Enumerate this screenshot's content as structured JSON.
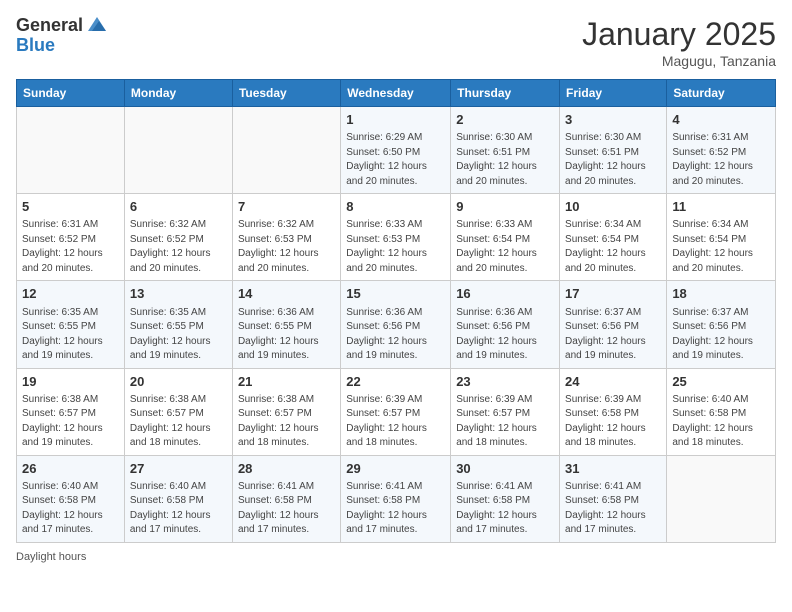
{
  "header": {
    "logo_general": "General",
    "logo_blue": "Blue",
    "month_title": "January 2025",
    "location": "Magugu, Tanzania"
  },
  "days_of_week": [
    "Sunday",
    "Monday",
    "Tuesday",
    "Wednesday",
    "Thursday",
    "Friday",
    "Saturday"
  ],
  "weeks": [
    [
      {
        "day": "",
        "info": ""
      },
      {
        "day": "",
        "info": ""
      },
      {
        "day": "",
        "info": ""
      },
      {
        "day": "1",
        "info": "Sunrise: 6:29 AM\nSunset: 6:50 PM\nDaylight: 12 hours\nand 20 minutes."
      },
      {
        "day": "2",
        "info": "Sunrise: 6:30 AM\nSunset: 6:51 PM\nDaylight: 12 hours\nand 20 minutes."
      },
      {
        "day": "3",
        "info": "Sunrise: 6:30 AM\nSunset: 6:51 PM\nDaylight: 12 hours\nand 20 minutes."
      },
      {
        "day": "4",
        "info": "Sunrise: 6:31 AM\nSunset: 6:52 PM\nDaylight: 12 hours\nand 20 minutes."
      }
    ],
    [
      {
        "day": "5",
        "info": "Sunrise: 6:31 AM\nSunset: 6:52 PM\nDaylight: 12 hours\nand 20 minutes."
      },
      {
        "day": "6",
        "info": "Sunrise: 6:32 AM\nSunset: 6:52 PM\nDaylight: 12 hours\nand 20 minutes."
      },
      {
        "day": "7",
        "info": "Sunrise: 6:32 AM\nSunset: 6:53 PM\nDaylight: 12 hours\nand 20 minutes."
      },
      {
        "day": "8",
        "info": "Sunrise: 6:33 AM\nSunset: 6:53 PM\nDaylight: 12 hours\nand 20 minutes."
      },
      {
        "day": "9",
        "info": "Sunrise: 6:33 AM\nSunset: 6:54 PM\nDaylight: 12 hours\nand 20 minutes."
      },
      {
        "day": "10",
        "info": "Sunrise: 6:34 AM\nSunset: 6:54 PM\nDaylight: 12 hours\nand 20 minutes."
      },
      {
        "day": "11",
        "info": "Sunrise: 6:34 AM\nSunset: 6:54 PM\nDaylight: 12 hours\nand 20 minutes."
      }
    ],
    [
      {
        "day": "12",
        "info": "Sunrise: 6:35 AM\nSunset: 6:55 PM\nDaylight: 12 hours\nand 19 minutes."
      },
      {
        "day": "13",
        "info": "Sunrise: 6:35 AM\nSunset: 6:55 PM\nDaylight: 12 hours\nand 19 minutes."
      },
      {
        "day": "14",
        "info": "Sunrise: 6:36 AM\nSunset: 6:55 PM\nDaylight: 12 hours\nand 19 minutes."
      },
      {
        "day": "15",
        "info": "Sunrise: 6:36 AM\nSunset: 6:56 PM\nDaylight: 12 hours\nand 19 minutes."
      },
      {
        "day": "16",
        "info": "Sunrise: 6:36 AM\nSunset: 6:56 PM\nDaylight: 12 hours\nand 19 minutes."
      },
      {
        "day": "17",
        "info": "Sunrise: 6:37 AM\nSunset: 6:56 PM\nDaylight: 12 hours\nand 19 minutes."
      },
      {
        "day": "18",
        "info": "Sunrise: 6:37 AM\nSunset: 6:56 PM\nDaylight: 12 hours\nand 19 minutes."
      }
    ],
    [
      {
        "day": "19",
        "info": "Sunrise: 6:38 AM\nSunset: 6:57 PM\nDaylight: 12 hours\nand 19 minutes."
      },
      {
        "day": "20",
        "info": "Sunrise: 6:38 AM\nSunset: 6:57 PM\nDaylight: 12 hours\nand 18 minutes."
      },
      {
        "day": "21",
        "info": "Sunrise: 6:38 AM\nSunset: 6:57 PM\nDaylight: 12 hours\nand 18 minutes."
      },
      {
        "day": "22",
        "info": "Sunrise: 6:39 AM\nSunset: 6:57 PM\nDaylight: 12 hours\nand 18 minutes."
      },
      {
        "day": "23",
        "info": "Sunrise: 6:39 AM\nSunset: 6:57 PM\nDaylight: 12 hours\nand 18 minutes."
      },
      {
        "day": "24",
        "info": "Sunrise: 6:39 AM\nSunset: 6:58 PM\nDaylight: 12 hours\nand 18 minutes."
      },
      {
        "day": "25",
        "info": "Sunrise: 6:40 AM\nSunset: 6:58 PM\nDaylight: 12 hours\nand 18 minutes."
      }
    ],
    [
      {
        "day": "26",
        "info": "Sunrise: 6:40 AM\nSunset: 6:58 PM\nDaylight: 12 hours\nand 17 minutes."
      },
      {
        "day": "27",
        "info": "Sunrise: 6:40 AM\nSunset: 6:58 PM\nDaylight: 12 hours\nand 17 minutes."
      },
      {
        "day": "28",
        "info": "Sunrise: 6:41 AM\nSunset: 6:58 PM\nDaylight: 12 hours\nand 17 minutes."
      },
      {
        "day": "29",
        "info": "Sunrise: 6:41 AM\nSunset: 6:58 PM\nDaylight: 12 hours\nand 17 minutes."
      },
      {
        "day": "30",
        "info": "Sunrise: 6:41 AM\nSunset: 6:58 PM\nDaylight: 12 hours\nand 17 minutes."
      },
      {
        "day": "31",
        "info": "Sunrise: 6:41 AM\nSunset: 6:58 PM\nDaylight: 12 hours\nand 17 minutes."
      },
      {
        "day": "",
        "info": ""
      }
    ]
  ],
  "footer": {
    "daylight_hours_label": "Daylight hours"
  }
}
